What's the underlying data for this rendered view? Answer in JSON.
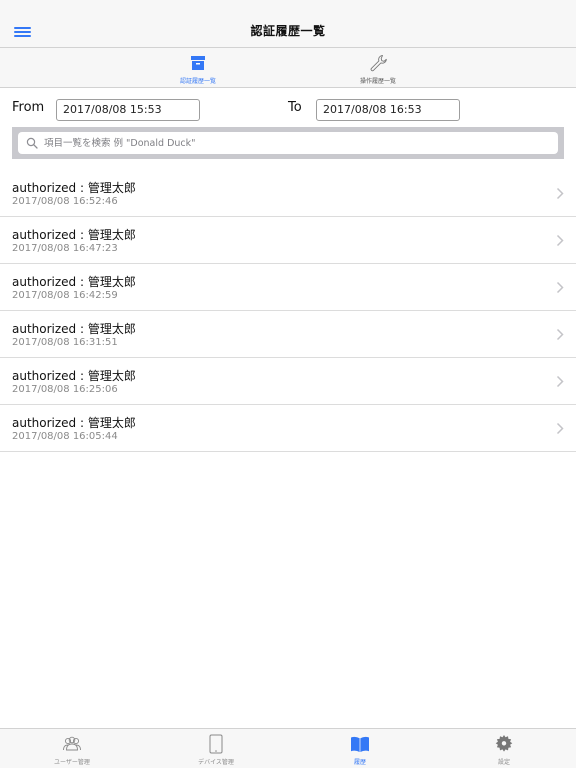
{
  "header": {
    "title": "認証履歴一覧",
    "menu_icon": "hamburger-menu-icon"
  },
  "segments": [
    {
      "label": "認証履歴一覧",
      "icon": "archive-box-icon",
      "active": true
    },
    {
      "label": "操作履歴一覧",
      "icon": "wrench-icon",
      "active": false
    }
  ],
  "filter": {
    "from_label": "From",
    "from_value": "2017/08/08 15:53",
    "to_label": "To",
    "to_value": "2017/08/08 16:53"
  },
  "search": {
    "placeholder": "項目一覧を検索 例 \"Donald Duck\"",
    "value": ""
  },
  "history": [
    {
      "title": "authorized : 管理太郎",
      "timestamp": "2017/08/08 16:52:46"
    },
    {
      "title": "authorized : 管理太郎",
      "timestamp": "2017/08/08 16:47:23"
    },
    {
      "title": "authorized : 管理太郎",
      "timestamp": "2017/08/08 16:42:59"
    },
    {
      "title": "authorized : 管理太郎",
      "timestamp": "2017/08/08 16:31:51"
    },
    {
      "title": "authorized : 管理太郎",
      "timestamp": "2017/08/08 16:25:06"
    },
    {
      "title": "authorized : 管理太郎",
      "timestamp": "2017/08/08 16:05:44"
    }
  ],
  "tabbar": [
    {
      "label": "ユーザー管理",
      "icon": "users-icon",
      "active": false
    },
    {
      "label": "デバイス管理",
      "icon": "tablet-icon",
      "active": false
    },
    {
      "label": "履歴",
      "icon": "book-icon",
      "active": true
    },
    {
      "label": "設定",
      "icon": "gear-icon",
      "active": false
    }
  ],
  "colors": {
    "accent": "#3478f6",
    "inactive": "#8a8a8a",
    "bar_background": "#f7f7f7",
    "search_frame": "#c9c9ce"
  }
}
